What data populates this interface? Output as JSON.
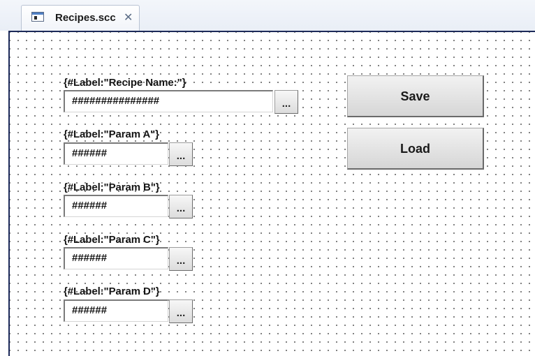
{
  "tab": {
    "icon": "screen-document-icon",
    "title": "Recipes.scc",
    "close_glyph": "✕"
  },
  "form": {
    "fields": [
      {
        "label": "{#Label:\"Recipe Name:\"}",
        "value": "###############",
        "browse": "..."
      },
      {
        "label": "{#Label:\"Param A\"}",
        "value": "######",
        "browse": "..."
      },
      {
        "label": "{#Label:\"Param B\"}",
        "value": "######",
        "browse": "..."
      },
      {
        "label": "{#Label:\"Param C\"}",
        "value": "######",
        "browse": "..."
      },
      {
        "label": "{#Label:\"Param D\"}",
        "value": "######",
        "browse": "..."
      }
    ]
  },
  "buttons": {
    "save": "Save",
    "load": "Load"
  }
}
